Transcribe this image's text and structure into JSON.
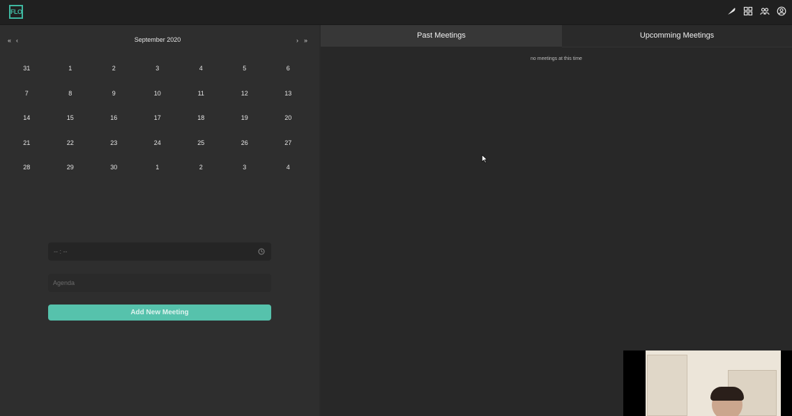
{
  "app": {
    "logo_text": "FLO",
    "accent_color": "#56c2ac"
  },
  "header": {
    "icons": [
      "feather-icon",
      "grid-icon",
      "users-icon",
      "profile-icon"
    ]
  },
  "calendar": {
    "month_label": "September 2020",
    "nav": {
      "prev_year": "«",
      "prev_month": "‹",
      "next_month": "›",
      "next_year": "»"
    },
    "weeks": [
      [
        "31",
        "1",
        "2",
        "3",
        "4",
        "5",
        "6"
      ],
      [
        "7",
        "8",
        "9",
        "10",
        "11",
        "12",
        "13"
      ],
      [
        "14",
        "15",
        "16",
        "17",
        "18",
        "19",
        "20"
      ],
      [
        "21",
        "22",
        "23",
        "24",
        "25",
        "26",
        "27"
      ],
      [
        "28",
        "29",
        "30",
        "1",
        "2",
        "3",
        "4"
      ]
    ]
  },
  "form": {
    "time_placeholder": "-- : --",
    "agenda_placeholder": "Agenda",
    "add_button_label": "Add New Meeting"
  },
  "meetings": {
    "tabs": [
      {
        "label": "Past Meetings",
        "active": true
      },
      {
        "label": "Upcomming Meetings",
        "active": false
      }
    ],
    "empty_message": "no meetings at this time"
  }
}
